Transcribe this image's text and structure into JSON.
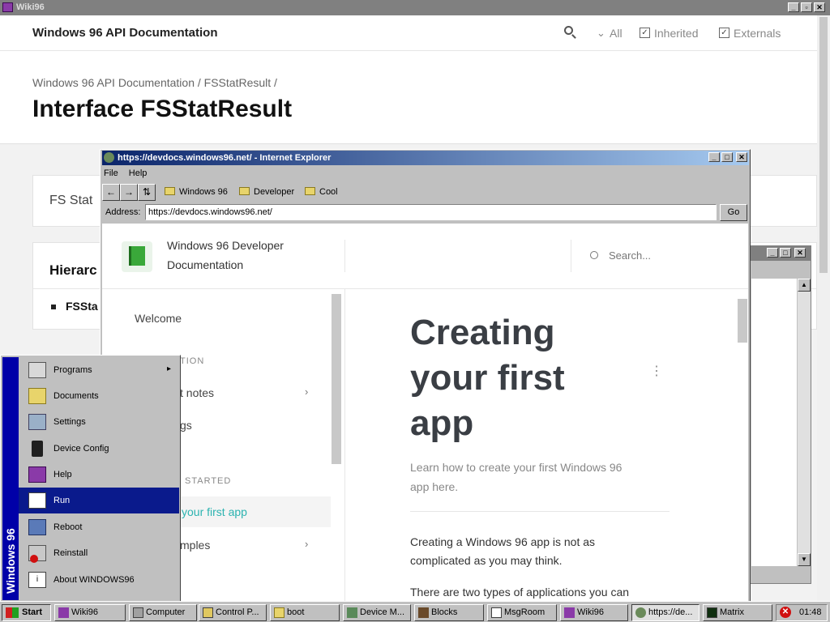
{
  "wiki_window": {
    "title": "Wiki96",
    "header_title": "Windows 96 API Documentation",
    "filters": [
      "All",
      "Inherited",
      "Externals"
    ],
    "breadcrumb": "Windows 96 API Documentation / FSStatResult /",
    "page_title": "Interface FSStatResult",
    "card_text": "FS Stat",
    "hierarchy_label": "Hierarc",
    "hierarchy_item": "FSSta"
  },
  "ie_window": {
    "title": "https://devdocs.windows96.net/ - Internet Explorer",
    "menu": [
      "File",
      "Help"
    ],
    "favorites": [
      "Windows 96",
      "Developer",
      "Cool"
    ],
    "address_label": "Address:",
    "address_value": "https://devdocs.windows96.net/",
    "go_label": "Go",
    "site": {
      "brand_line1": "Windows 96 Developer",
      "brand_line2": "Documentation",
      "search_placeholder": "Search...",
      "welcome": "Welcome",
      "section1": "TION",
      "item_notes": "t notes",
      "item_gs": "gs",
      "section2": "STARTED",
      "item_first_app": "your first app",
      "item_samples": "mples",
      "heading_line1": "Creating",
      "heading_line2": "your first",
      "heading_line3": "app",
      "subtitle_line1": "Learn how to create your first Windows 96",
      "subtitle_line2": "app here.",
      "para1_line1": "Creating a Windows 96 app is not as",
      "para1_line2": "complicated as you may think.",
      "para2_line1": "There are two types of applications you can"
    }
  },
  "start_menu": {
    "banner": "Windows 96",
    "items": [
      "Programs",
      "Documents",
      "Settings",
      "Device Config",
      "Help",
      "Run",
      "Reboot",
      "Reinstall",
      "About WINDOWS96"
    ],
    "highlighted": "Run"
  },
  "taskbar": {
    "start_label": "Start",
    "items": [
      "Wiki96",
      "Computer",
      "Control P...",
      "boot",
      "Device M...",
      "Blocks",
      "MsgRoom",
      "Wiki96",
      "https://de...",
      "Matrix"
    ],
    "active_item": "https://de...",
    "clock": "01:48"
  },
  "colors": {
    "titlebar_active": "#0a246a",
    "titlebar_inactive": "#808080",
    "menu_highlight": "#0a1a8c",
    "link_teal": "#2bb3b0"
  }
}
